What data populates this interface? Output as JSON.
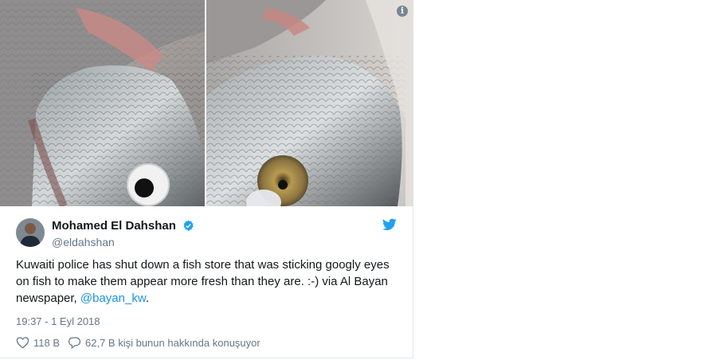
{
  "tweet": {
    "author_name": "Mohamed El Dahshan",
    "handle": "@eldahshan",
    "text_main": "Kuwaiti police has shut down a fish store that was sticking googly eyes on fish to make them appear more fresh than they are. :-) via Al Bayan newspaper, ",
    "mention": "@bayan_kw",
    "text_end": ".",
    "timestamp": "19:37 - 1 Eyl 2018",
    "likes": "118 B",
    "replies_text": "62,7 B kişi bunun hakkında konuşuyor"
  },
  "icons": {
    "info": "info-icon",
    "verified": "verified-badge-icon",
    "brand": "twitter-bird-icon",
    "like": "heart-icon",
    "reply": "speech-bubble-icon"
  },
  "colors": {
    "link": "#1b95e0",
    "secondary_text": "#657786",
    "verified": "#1da1f2",
    "border": "#e1e8ed"
  }
}
